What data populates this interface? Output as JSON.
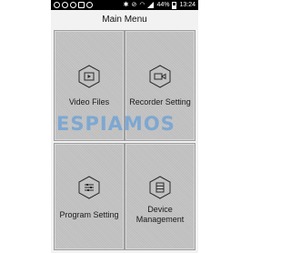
{
  "status_bar": {
    "time": "13:24",
    "battery": "44%",
    "left_icons": [
      "skype-icon",
      "whatsapp-icon",
      "chat-icon",
      "mail-icon",
      "notification-icon"
    ],
    "right_icons": [
      "bluetooth-icon",
      "mute-icon",
      "wifi-icon",
      "signal-icon",
      "battery-icon"
    ]
  },
  "header": {
    "title": "Main Menu"
  },
  "menu": {
    "items": [
      {
        "label": "Video Files",
        "icon": "video-file-icon"
      },
      {
        "label": "Recorder Setting",
        "icon": "camera-icon"
      },
      {
        "label": "Program Setting",
        "icon": "settings-sliders-icon"
      },
      {
        "label_line1": "Device",
        "label_line2": "Management",
        "icon": "storage-icon"
      }
    ]
  },
  "watermark": {
    "text": "ESPIAMOS"
  },
  "colors": {
    "status_bar": "#000000",
    "background": "#f2f2f2",
    "tile": "#c2c2c2",
    "watermark": "#5096dc"
  }
}
